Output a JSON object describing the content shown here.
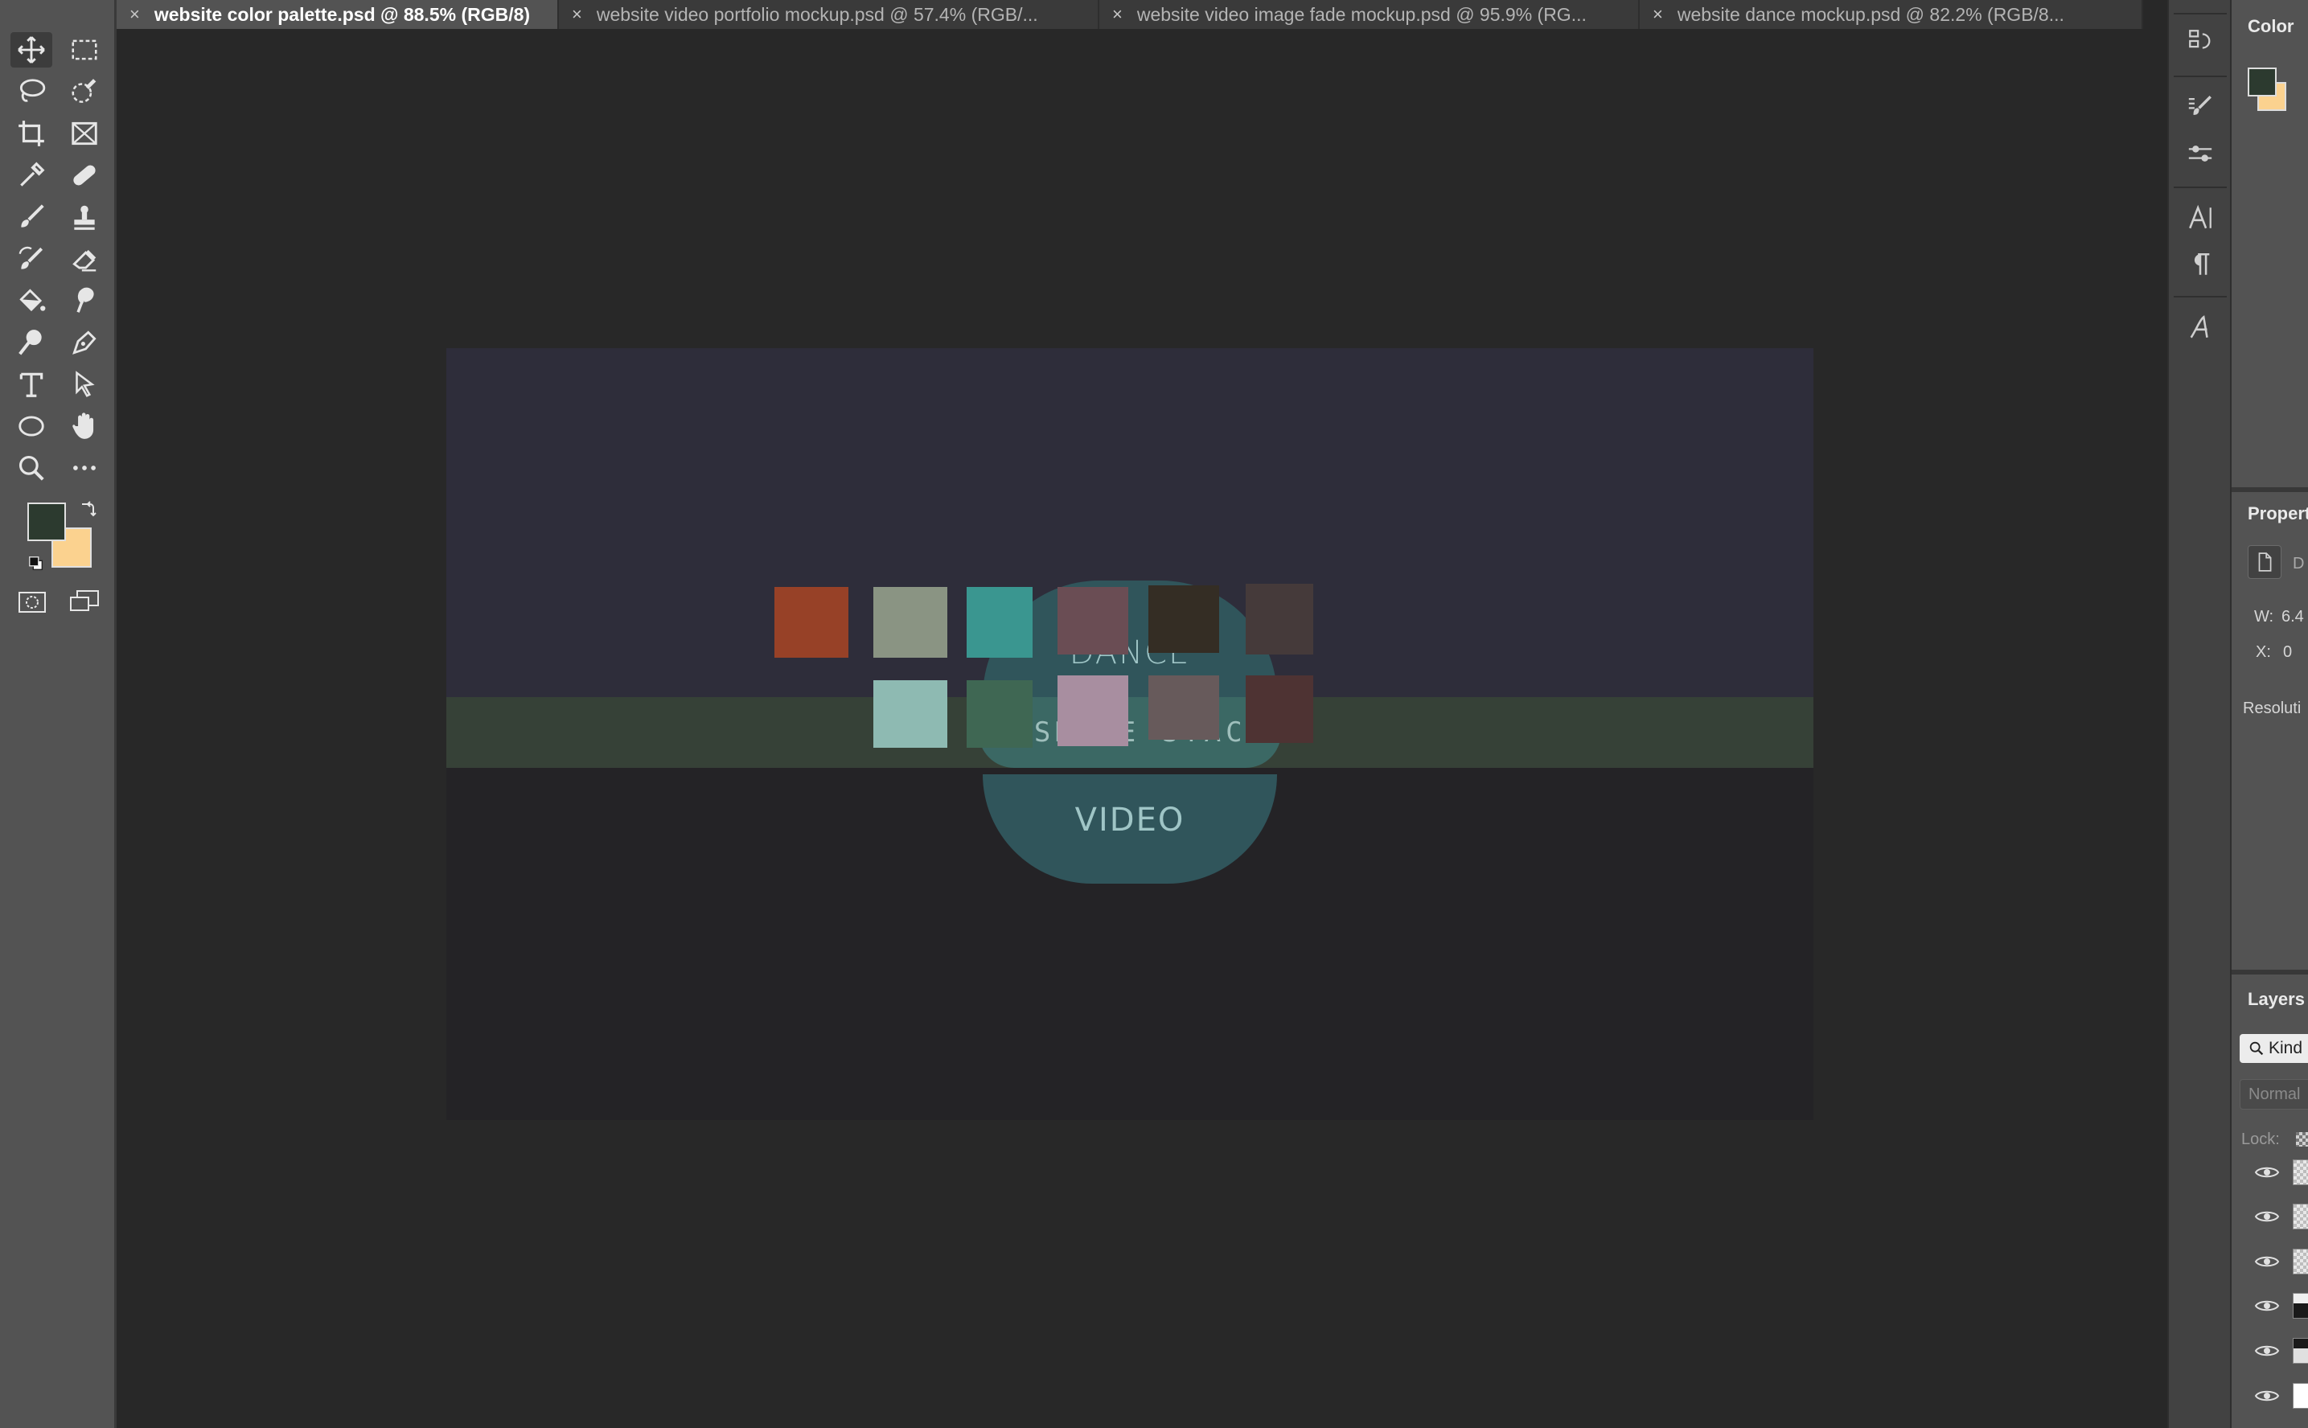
{
  "tabs": [
    {
      "label": "website color palette.psd @ 88.5% (RGB/8)",
      "active": true
    },
    {
      "label": "website video portfolio mockup.psd @ 57.4% (RGB/...",
      "active": false
    },
    {
      "label": "website video image fade mockup.psd @ 95.9% (RG...",
      "active": false
    },
    {
      "label": "website dance mockup.psd @ 82.2% (RGB/8...",
      "active": false
    }
  ],
  "tab_close_glyph": "×",
  "toolbar": {
    "tools": [
      "move-tool-icon",
      "marquee-tool-icon",
      "lasso-tool-icon",
      "quick-selection-tool-icon",
      "crop-tool-icon",
      "frame-tool-icon",
      "eyedropper-tool-icon",
      "healing-brush-tool-icon",
      "brush-tool-icon",
      "clone-stamp-tool-icon",
      "history-brush-tool-icon",
      "eraser-tool-icon",
      "paint-bucket-tool-icon",
      "smudge-tool-icon",
      "dodge-tool-icon",
      "pen-tool-icon",
      "type-tool-icon",
      "path-selection-tool-icon",
      "ellipse-tool-icon",
      "hand-tool-icon",
      "zoom-tool-icon",
      "more-tools-icon"
    ],
    "foreground_color": "#2c3a2f",
    "background_color": "#fbd28f"
  },
  "canvas": {
    "top_word": "DANCE",
    "middle_word": "JASMINE STACK",
    "bottom_word": "VIDEO",
    "colors": {
      "top_band": "#2e2d3a",
      "middle_band": "#364137",
      "bottom_band": "#242326",
      "circle": "#30555b",
      "circle_middle": "#3b6864"
    },
    "palette_row1": [
      "#974127",
      "#8a9483",
      "#3a9690",
      "#6a4d54",
      "#342d24",
      "#453a3a"
    ],
    "palette_row2": [
      "#8ebab2",
      "#3f6753",
      "#a88ea0",
      "#675a5b",
      "#4e3333"
    ]
  },
  "panels": {
    "color_title": "Color",
    "properties_title": "Propert",
    "properties_doc_label": "D",
    "width_label": "W:",
    "width_value": "6.4",
    "x_label": "X:",
    "x_value": "0",
    "resolution_label": "Resoluti",
    "layers_title": "Layers",
    "kind_label": "Kind",
    "blend_mode": "Normal",
    "lock_label": "Lock:",
    "layer_count_visible": 6
  }
}
